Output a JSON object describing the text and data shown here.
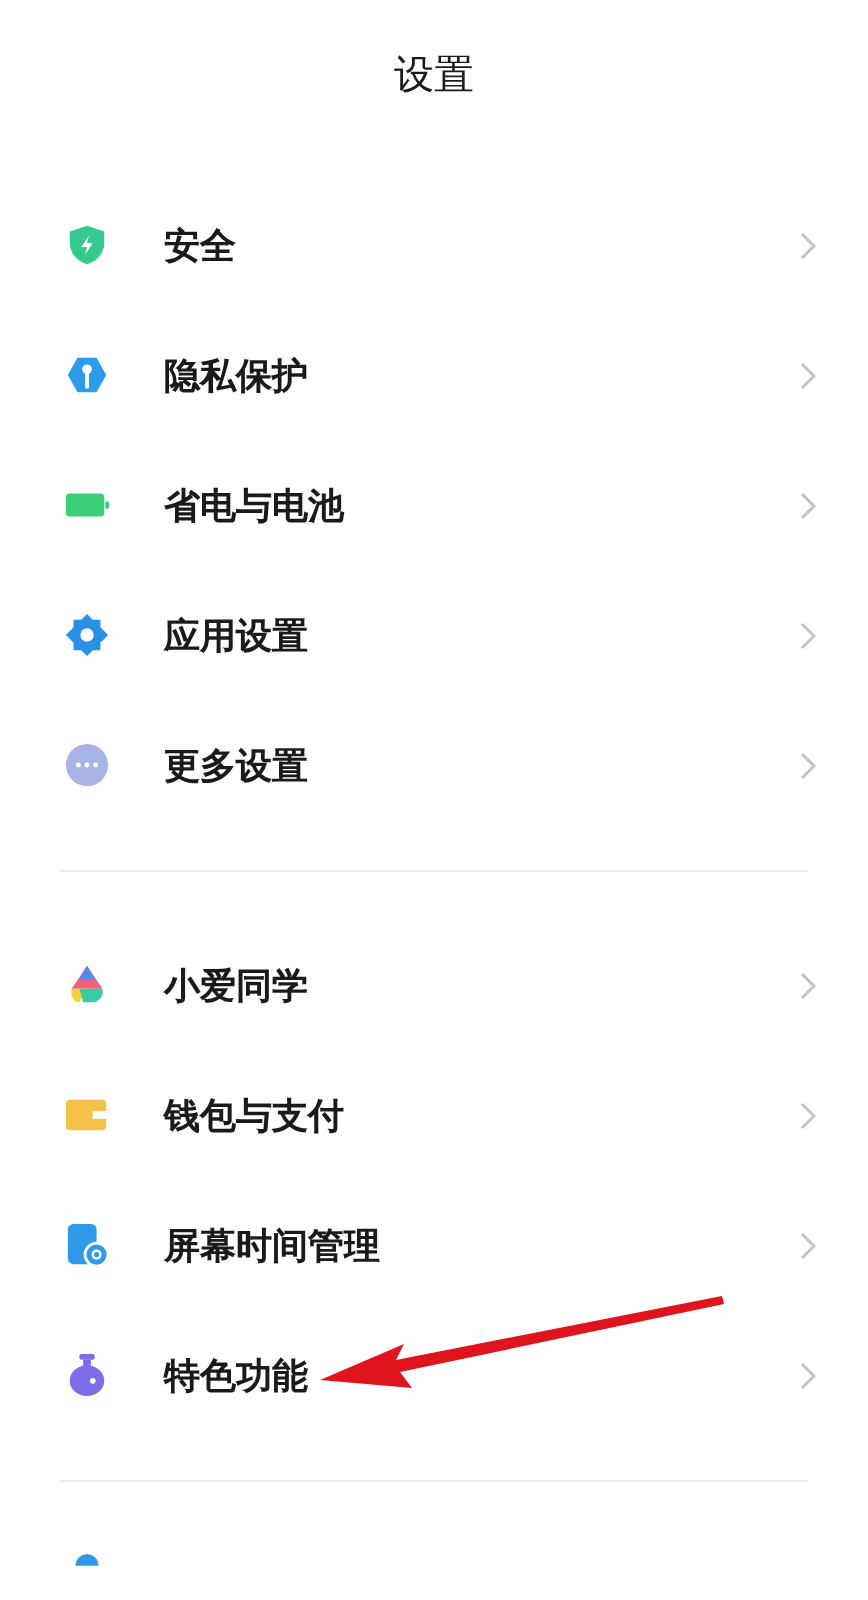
{
  "title": "设置",
  "groups": [
    {
      "items": [
        {
          "label": "安全"
        },
        {
          "label": "隐私保护"
        },
        {
          "label": "省电与电池"
        },
        {
          "label": "应用设置"
        },
        {
          "label": "更多设置"
        }
      ]
    },
    {
      "items": [
        {
          "label": "小爱同学"
        },
        {
          "label": "钱包与支付"
        },
        {
          "label": "屏幕时间管理"
        },
        {
          "label": "特色功能"
        }
      ]
    }
  ]
}
